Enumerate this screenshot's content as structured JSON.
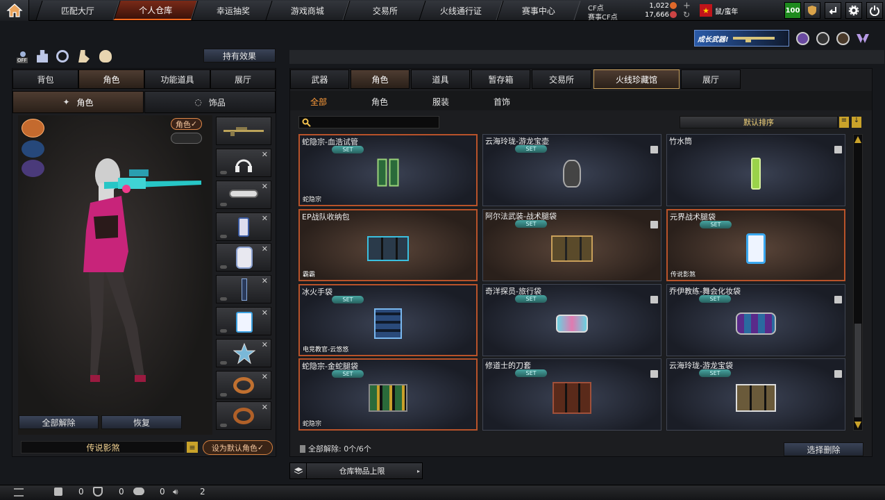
{
  "nav": {
    "tabs": [
      {
        "label": "匹配大厅"
      },
      {
        "label": "个人仓库"
      },
      {
        "label": "幸运抽奖"
      },
      {
        "label": "游戏商城"
      },
      {
        "label": "交易所"
      },
      {
        "label": "火线通行证"
      },
      {
        "label": "赛事中心"
      }
    ],
    "active_tab": "个人仓库"
  },
  "currency": {
    "cf_label": "CF点",
    "cf_value": "1,022",
    "event_label": "赛事CF点",
    "event_value": "17,666"
  },
  "user": {
    "name": "鼠/蛮年",
    "level": "100"
  },
  "promo": {
    "banner_text": "成长武器!"
  },
  "left": {
    "toggle_label": "OFF",
    "effects_button": "持有效果",
    "tabs": [
      {
        "label": "背包"
      },
      {
        "label": "角色"
      },
      {
        "label": "功能道具"
      },
      {
        "label": "展厅"
      }
    ],
    "subtabs": [
      {
        "label": "角色"
      },
      {
        "label": "饰品"
      }
    ],
    "role_badge": "角色",
    "unequip_all": "全部解除",
    "restore": "恢复",
    "character_name": "传说影煞",
    "set_default": "设为默认角色"
  },
  "right": {
    "tabs": [
      {
        "label": "武器"
      },
      {
        "label": "角色"
      },
      {
        "label": "道具"
      },
      {
        "label": "暂存箱"
      },
      {
        "label": "交易所"
      },
      {
        "label": "火线珍藏馆"
      },
      {
        "label": "展厅"
      }
    ],
    "subtabs": [
      {
        "label": "全部"
      },
      {
        "label": "角色"
      },
      {
        "label": "服装"
      },
      {
        "label": "首饰"
      }
    ],
    "search_placeholder": "",
    "sort_label": "默认排序",
    "items": [
      {
        "name": "蛇隐宗-血浩试管",
        "set": "SET",
        "tag": "蛇隐宗"
      },
      {
        "name": "云海玲珑-游龙宝壶",
        "set": "SET",
        "tag": ""
      },
      {
        "name": "竹水筒",
        "set": "",
        "tag": ""
      },
      {
        "name": "EP战队收纳包",
        "set": "",
        "tag": "霸霸"
      },
      {
        "name": "阿尔法武装-战术腿袋",
        "set": "SET",
        "tag": ""
      },
      {
        "name": "元界战术腿袋",
        "set": "SET",
        "tag": "传说影煞"
      },
      {
        "name": "冰火手袋",
        "set": "SET",
        "tag": "电竞教官-云悠悠"
      },
      {
        "name": "奇洋探员-旅行袋",
        "set": "SET",
        "tag": ""
      },
      {
        "name": "乔伊教练-舞会化妆袋",
        "set": "SET",
        "tag": ""
      },
      {
        "name": "蛇隐宗-金蛇腿袋",
        "set": "SET",
        "tag": "蛇隐宗"
      },
      {
        "name": "修道士的刀套",
        "set": "SET",
        "tag": ""
      },
      {
        "name": "云海玲珑-游龙宝袋",
        "set": "SET",
        "tag": ""
      }
    ],
    "footer_count": "全部解除: 0个/6个",
    "select_delete": "选择删除",
    "capacity_label": "仓库物品上限"
  },
  "statusbar": {
    "count1": "0",
    "count2": "0",
    "count3": "0",
    "count4": "2"
  },
  "colors": {
    "accent": "#ff6a1f",
    "set_badge": "#3f9c98",
    "level_badge": "#1e8a1e"
  }
}
